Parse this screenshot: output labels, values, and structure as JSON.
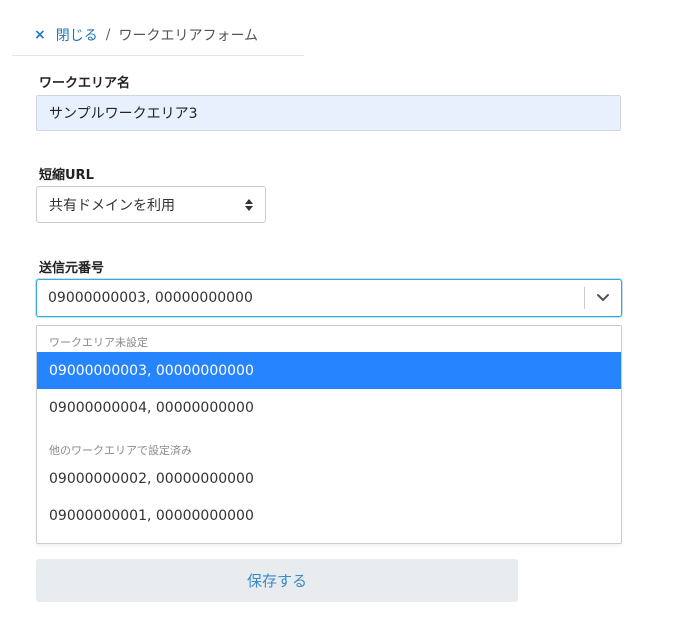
{
  "breadcrumb": {
    "close_icon": "×",
    "close_label": "閉じる",
    "separator": "/",
    "current": "ワークエリアフォーム"
  },
  "workarea_name": {
    "label": "ワークエリア名",
    "value": "サンプルワークエリア3"
  },
  "short_url": {
    "label": "短縮URL",
    "selected": "共有ドメインを利用"
  },
  "sender_number": {
    "label": "送信元番号",
    "selected": "09000000003, 00000000000",
    "groups": [
      {
        "heading": "ワークエリア未設定",
        "options": [
          {
            "label": "09000000003, 00000000000",
            "selected": true
          },
          {
            "label": "09000000004, 00000000000",
            "selected": false
          }
        ]
      },
      {
        "heading": "他のワークエリアで設定済み",
        "options": [
          {
            "label": "09000000002, 00000000000",
            "selected": false
          },
          {
            "label": "09000000001, 00000000000",
            "selected": false
          }
        ]
      }
    ]
  },
  "save_button": {
    "label": "保存する"
  },
  "colors": {
    "link": "#1f7ab8",
    "selected_option_bg": "#2684ff",
    "focus_border": "#3ba8dc",
    "input_bg": "#e8f0fe",
    "button_bg": "#e8ecef",
    "button_text": "#3a8ac4"
  },
  "icons": {
    "close": "close-icon",
    "select_arrows": "select-updown-icon",
    "combo_chevron": "chevron-down-icon"
  }
}
